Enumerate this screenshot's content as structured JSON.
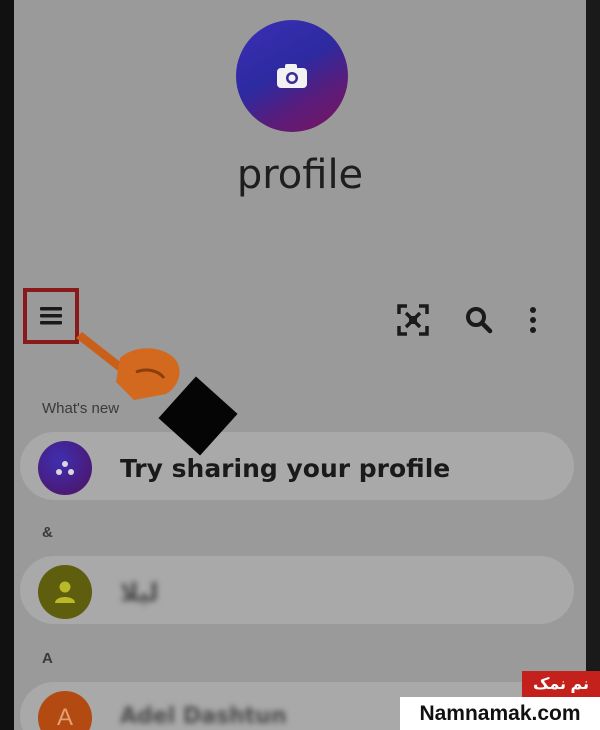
{
  "profile": {
    "name": "profile"
  },
  "toolbar": {
    "menu_icon": "hamburger-menu-icon",
    "scan_icon": "qr-scan-icon",
    "search_icon": "search-icon",
    "more_icon": "more-vertical-icon"
  },
  "sections": {
    "whats_new": "What's new",
    "ampersand": "&",
    "a": "A"
  },
  "whats_new_card": {
    "text": "Try sharing your profile"
  },
  "contacts": [
    {
      "name": "لیلا",
      "avatar_initial": ""
    },
    {
      "name": "Adel Dashtun",
      "avatar_initial": "A"
    }
  ],
  "watermark": {
    "persian": "نم نمک",
    "site": "Namnamak.com"
  },
  "colors": {
    "highlight_border": "#8a1a1a",
    "pointer_orange": "#d2691e",
    "watermark_red": "#c4201c"
  }
}
